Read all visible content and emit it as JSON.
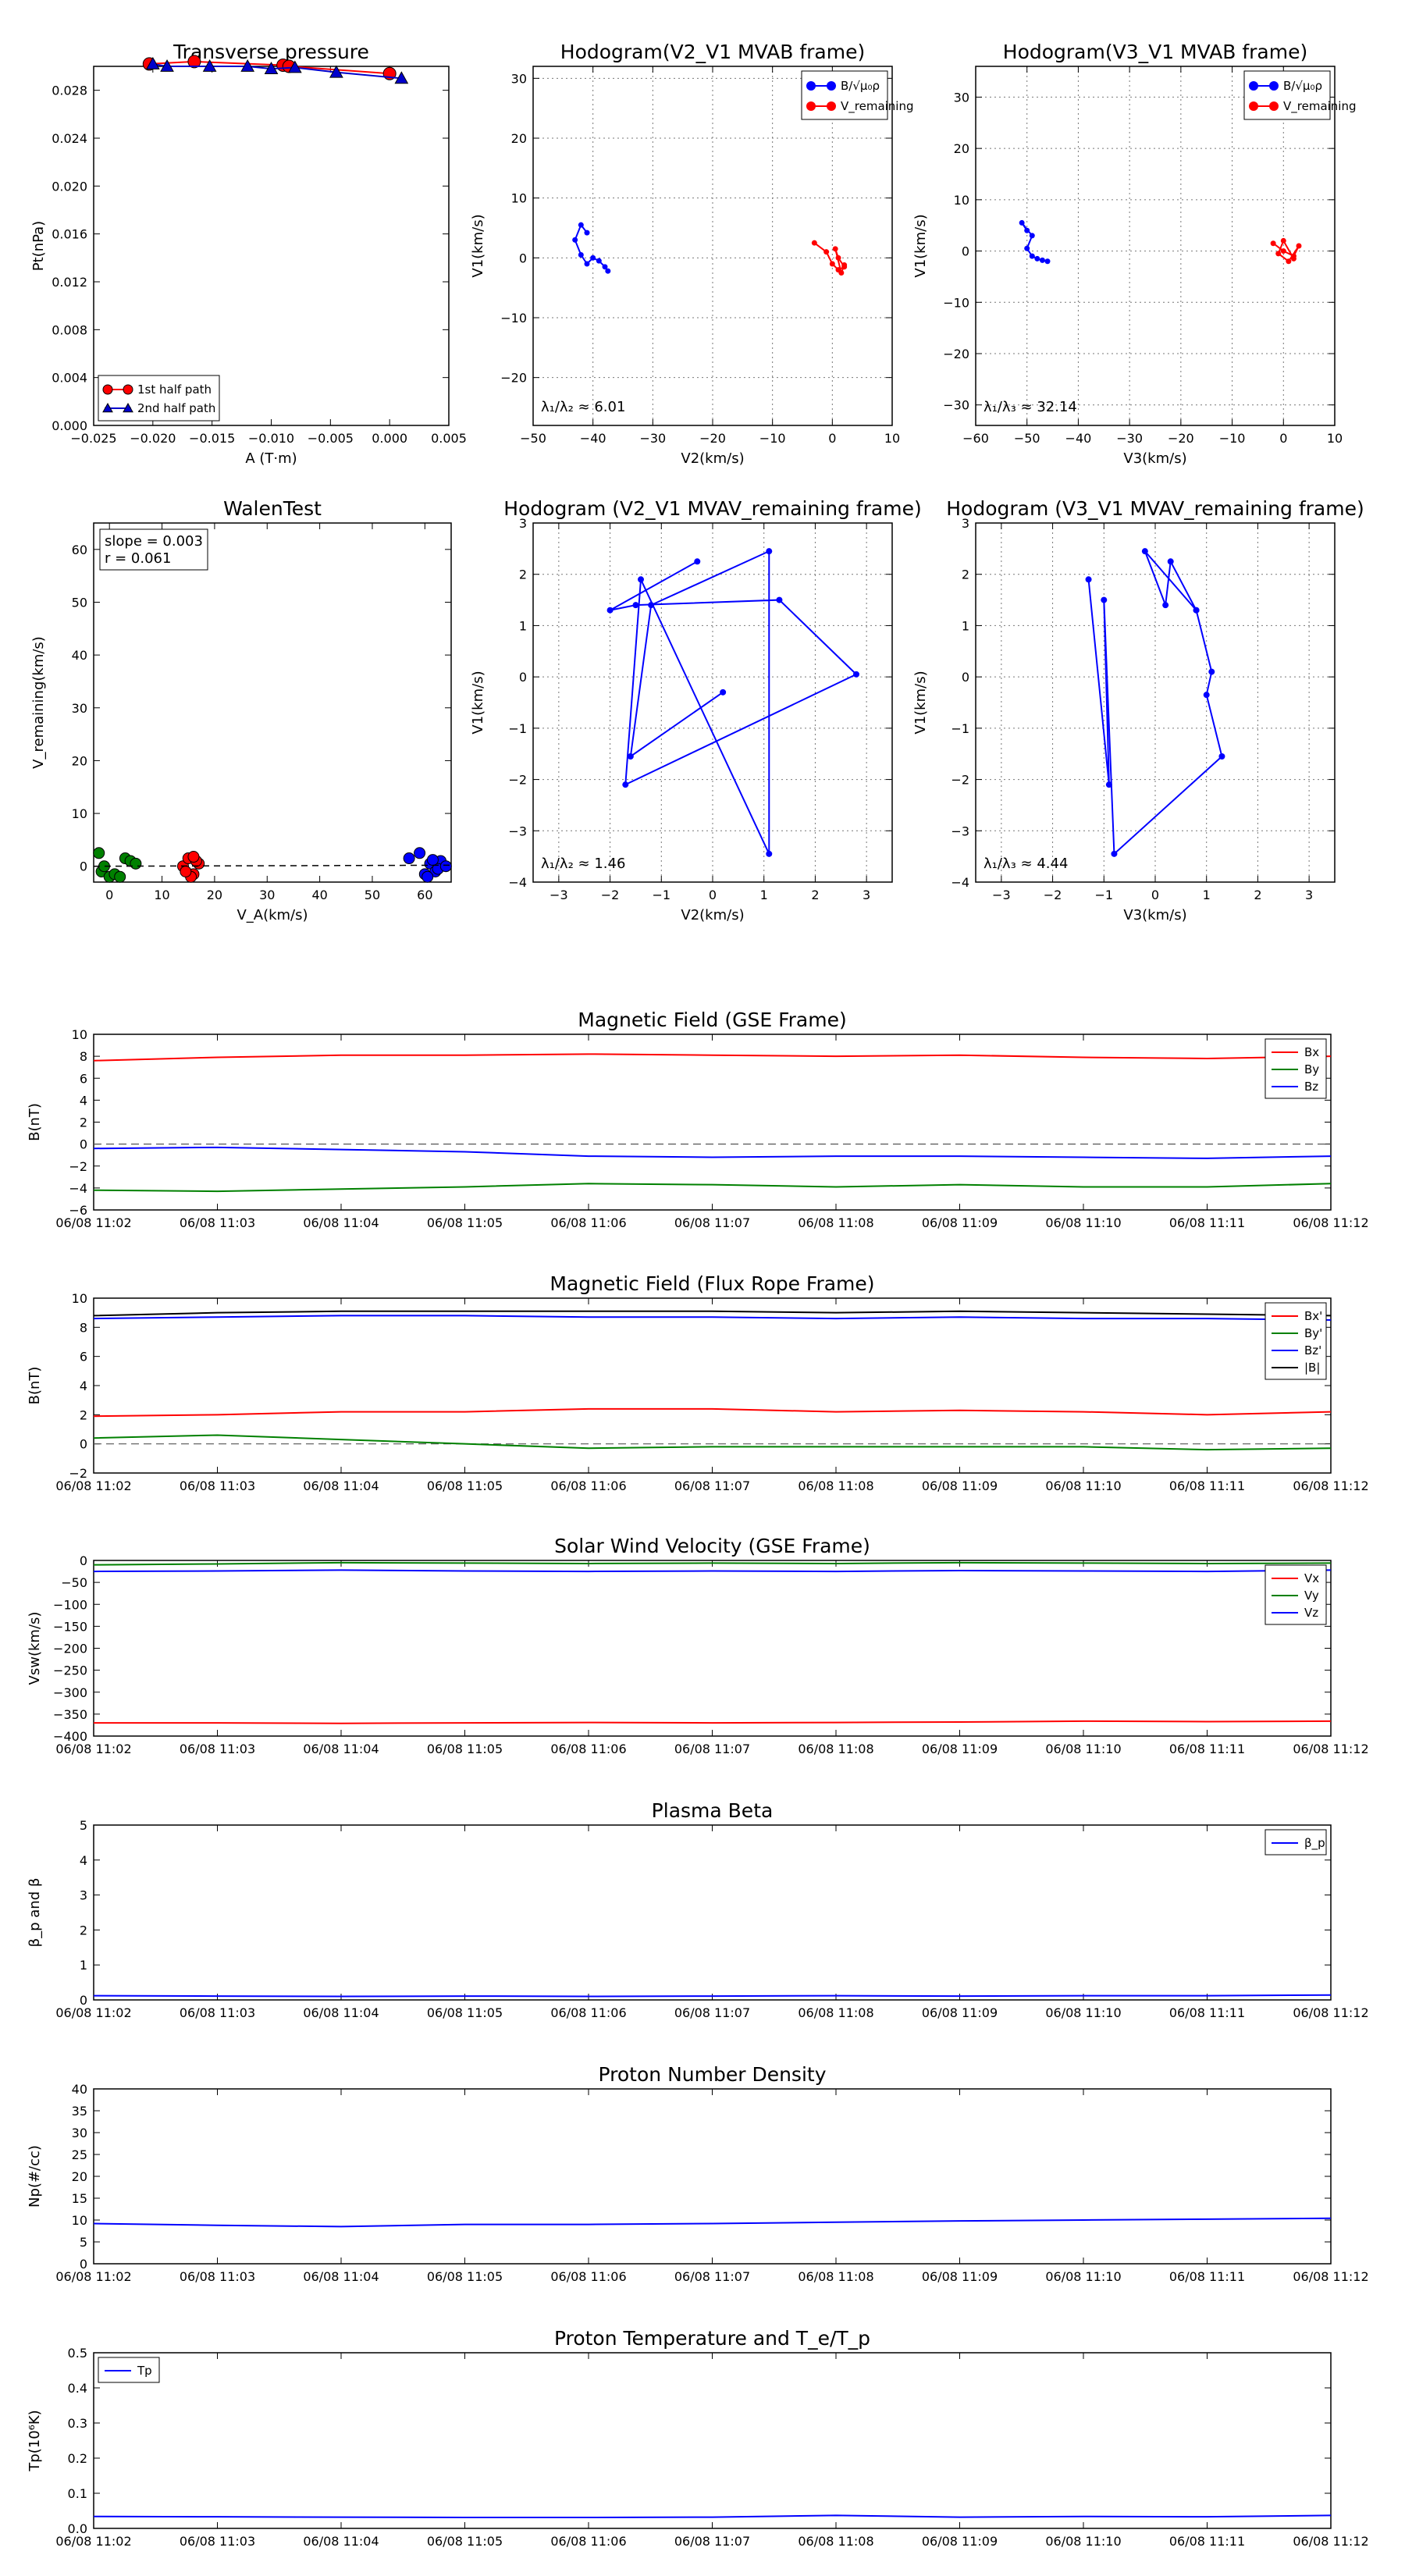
{
  "time_ticks": [
    "06/08 11:02",
    "06/08 11:03",
    "06/08 11:04",
    "06/08 11:05",
    "06/08 11:06",
    "06/08 11:07",
    "06/08 11:08",
    "06/08 11:09",
    "06/08 11:10",
    "06/08 11:11",
    "06/08 11:12"
  ],
  "chart_data": [
    {
      "id": "transverse",
      "type": "scatter",
      "title": "Transverse pressure",
      "xlabel": "A (T·m)",
      "ylabel": "Pt(nPa)",
      "xlim": [
        -0.025,
        0.005
      ],
      "ylim": [
        0,
        0.03
      ],
      "xticks": [
        -0.025,
        -0.02,
        -0.015,
        -0.01,
        -0.005,
        0.0,
        0.005
      ],
      "xtick_labels": [
        "−0.025",
        "−0.020",
        "−0.015",
        "−0.010",
        "−0.005",
        "0.000",
        "0.005"
      ],
      "yticks": [
        0,
        0.004,
        0.008,
        0.012,
        0.016,
        0.02,
        0.024,
        0.028
      ],
      "ytick_labels": [
        "0.000",
        "0.004",
        "0.008",
        "0.012",
        "0.016",
        "0.020",
        "0.024",
        "0.028"
      ],
      "grid": false,
      "legend": "bottom-left",
      "series": [
        {
          "name": "1st half path",
          "color": "#ff0000",
          "marker": "circle",
          "x": [
            -0.0203,
            -0.0165,
            -0.009,
            -0.0085,
            0.0
          ],
          "y": [
            0.0302,
            0.0304,
            0.0301,
            0.03,
            0.0294
          ]
        },
        {
          "name": "2nd half path",
          "color": "#0000cc",
          "marker": "triangle",
          "x": [
            -0.02,
            -0.0188,
            -0.0152,
            -0.012,
            -0.01,
            -0.008,
            -0.0045,
            0.001
          ],
          "y": [
            0.0302,
            0.03,
            0.03,
            0.03,
            0.0298,
            0.0299,
            0.0295,
            0.029
          ]
        }
      ]
    },
    {
      "id": "hodo1",
      "type": "scatter",
      "title": "Hodogram(V2_V1 MVAB frame)",
      "xlabel": "V2(km/s)",
      "ylabel": "V1(km/s)",
      "xlim": [
        -50,
        10
      ],
      "ylim": [
        -28,
        32
      ],
      "xticks": [
        -50,
        -40,
        -30,
        -20,
        -10,
        0,
        10
      ],
      "yticks": [
        -20,
        -10,
        0,
        10,
        20,
        30
      ],
      "grid": true,
      "legend": "top-right",
      "annotation": "λ₁/λ₂ ≈ 6.01",
      "series": [
        {
          "name": "B/√μ₀ρ",
          "color": "#0000ff",
          "x": [
            -41,
            -42,
            -43,
            -42,
            -41,
            -40,
            -39,
            -38,
            -37.5
          ],
          "y": [
            4.2,
            5.5,
            3.0,
            0.5,
            -1,
            0,
            -0.5,
            -1.5,
            -2.2
          ]
        },
        {
          "name": "V_remaining",
          "color": "#ff0000",
          "x": [
            -3,
            -1,
            0,
            1,
            2,
            1,
            0.5,
            1.5,
            2
          ],
          "y": [
            2.5,
            1,
            -1,
            -2,
            -1.5,
            0,
            1.5,
            -2.5,
            -1.2
          ]
        }
      ]
    },
    {
      "id": "hodo2",
      "type": "scatter",
      "title": "Hodogram(V3_V1 MVAB frame)",
      "xlabel": "V3(km/s)",
      "ylabel": "V1(km/s)",
      "xlim": [
        -60,
        10
      ],
      "ylim": [
        -34,
        36
      ],
      "xticks": [
        -60,
        -50,
        -40,
        -30,
        -20,
        -10,
        0,
        10
      ],
      "yticks": [
        -30,
        -20,
        -10,
        0,
        10,
        20,
        30
      ],
      "grid": true,
      "legend": "top-right",
      "annotation": "λ₁/λ₃ ≈ 32.14",
      "series": [
        {
          "name": "B/√μ₀ρ",
          "color": "#0000ff",
          "x": [
            -50,
            -51,
            -49,
            -50,
            -49,
            -48,
            -47,
            -46
          ],
          "y": [
            4,
            5.5,
            3,
            0.5,
            -1,
            -1.5,
            -1.8,
            -2
          ]
        },
        {
          "name": "V_remaining",
          "color": "#ff0000",
          "x": [
            -2,
            0,
            2,
            3,
            1,
            -1,
            0,
            2
          ],
          "y": [
            1.5,
            0,
            -1,
            1,
            -2,
            -0.5,
            2,
            -1.5
          ]
        }
      ]
    },
    {
      "id": "walen",
      "type": "scatter",
      "title": "WalenTest",
      "xlabel": "V_A(km/s)",
      "ylabel": "V_remaining(km/s)",
      "xlim": [
        -3,
        65
      ],
      "ylim": [
        -3,
        65
      ],
      "xticks": [
        0,
        10,
        20,
        30,
        40,
        50,
        60
      ],
      "yticks": [
        0,
        10,
        20,
        30,
        40,
        50,
        60
      ],
      "grid": false,
      "box_text": [
        "slope = 0.003",
        "r = 0.061"
      ],
      "fit": {
        "slope": 0.003,
        "intercept": 0
      },
      "series": [
        {
          "color": "#008000",
          "x": [
            -2,
            -1.5,
            0,
            -1,
            1,
            2,
            3,
            4,
            5
          ],
          "y": [
            2.5,
            -1,
            -2,
            0,
            -1.5,
            -2,
            1.5,
            1,
            0.5
          ]
        },
        {
          "color": "#ff0000",
          "x": [
            14,
            15,
            16,
            17,
            15.5,
            16.5,
            14.5,
            16
          ],
          "y": [
            0,
            1.5,
            -1.5,
            0.5,
            -2,
            1,
            -1,
            1.8
          ]
        },
        {
          "color": "#0000ff",
          "x": [
            57,
            59,
            60,
            61,
            62,
            63,
            60.5,
            62.5,
            64,
            61.5
          ],
          "y": [
            1.5,
            2.5,
            -1.5,
            0.5,
            -1,
            1,
            -2,
            -0.5,
            0,
            1.2
          ]
        }
      ]
    },
    {
      "id": "hodo3",
      "type": "line",
      "title": "Hodogram (V2_V1 MVAV_remaining frame)",
      "xlabel": "V2(km/s)",
      "ylabel": "V1(km/s)",
      "xlim": [
        -3.5,
        3.5
      ],
      "ylim": [
        -4,
        3
      ],
      "xticks": [
        -3,
        -2,
        -1,
        0,
        1,
        2,
        3
      ],
      "yticks": [
        -4,
        -3,
        -2,
        -1,
        0,
        1,
        2,
        3
      ],
      "grid": true,
      "annotation": "λ₁/λ₂ ≈ 1.46",
      "series": [
        {
          "color": "#0000ff",
          "x": [
            -0.3,
            -2.0,
            -1.5,
            1.3,
            2.8,
            -1.7,
            -1.4,
            1.1,
            1.1,
            -1.2,
            -1.6,
            0.2
          ],
          "y": [
            2.25,
            1.3,
            1.4,
            1.5,
            0.05,
            -2.1,
            1.9,
            -3.45,
            2.45,
            1.4,
            -1.55,
            -0.3
          ]
        }
      ]
    },
    {
      "id": "hodo4",
      "type": "line",
      "title": "Hodogram (V3_V1 MVAV_remaining frame)",
      "xlabel": "V3(km/s)",
      "ylabel": "V1(km/s)",
      "xlim": [
        -3.5,
        3.5
      ],
      "ylim": [
        -4,
        3
      ],
      "xticks": [
        -3,
        -2,
        -1,
        0,
        1,
        2,
        3
      ],
      "yticks": [
        -4,
        -3,
        -2,
        -1,
        0,
        1,
        2,
        3
      ],
      "grid": true,
      "annotation": "λ₁/λ₃ ≈ 4.44",
      "series": [
        {
          "color": "#0000ff",
          "x": [
            -1.3,
            -0.9,
            -1.0,
            -0.8,
            1.3,
            1.0,
            1.1,
            0.8,
            0.3,
            0.2,
            -0.2,
            0.8
          ],
          "y": [
            1.9,
            -2.1,
            1.5,
            -3.45,
            -1.55,
            -0.35,
            0.1,
            1.3,
            2.25,
            1.4,
            2.45,
            1.3
          ]
        }
      ]
    },
    {
      "id": "mag_gse",
      "type": "line",
      "title": "Magnetic Field (GSE Frame)",
      "ylabel": "B(nT)",
      "ylim": [
        -6,
        10
      ],
      "yticks": [
        -6,
        -4,
        -2,
        0,
        2,
        4,
        6,
        8,
        10
      ],
      "hline": 0,
      "legend": "top-right",
      "series": [
        {
          "name": "Bx",
          "color": "#ff0000",
          "values": [
            7.6,
            7.9,
            8.1,
            8.1,
            8.2,
            8.1,
            8.0,
            8.1,
            7.9,
            7.8,
            8.0
          ]
        },
        {
          "name": "By",
          "color": "#008000",
          "values": [
            -4.2,
            -4.3,
            -4.1,
            -3.9,
            -3.6,
            -3.7,
            -3.9,
            -3.7,
            -3.9,
            -3.9,
            -3.6
          ]
        },
        {
          "name": "Bz",
          "color": "#0000ff",
          "values": [
            -0.4,
            -0.3,
            -0.5,
            -0.7,
            -1.1,
            -1.2,
            -1.1,
            -1.1,
            -1.2,
            -1.3,
            -1.1
          ]
        }
      ]
    },
    {
      "id": "mag_fr",
      "type": "line",
      "title": "Magnetic Field (Flux Rope Frame)",
      "ylabel": "B(nT)",
      "ylim": [
        -2,
        10
      ],
      "yticks": [
        -2,
        0,
        2,
        4,
        6,
        8,
        10
      ],
      "hline": 0,
      "legend": "top-right",
      "series": [
        {
          "name": "Bx'",
          "color": "#ff0000",
          "values": [
            1.9,
            2.0,
            2.2,
            2.2,
            2.4,
            2.4,
            2.2,
            2.3,
            2.2,
            2.0,
            2.2
          ]
        },
        {
          "name": "By'",
          "color": "#008000",
          "values": [
            0.4,
            0.6,
            0.3,
            0.0,
            -0.3,
            -0.2,
            -0.2,
            -0.2,
            -0.2,
            -0.4,
            -0.3
          ]
        },
        {
          "name": "Bz'",
          "color": "#0000ff",
          "values": [
            8.6,
            8.7,
            8.8,
            8.8,
            8.7,
            8.7,
            8.6,
            8.7,
            8.6,
            8.6,
            8.5
          ]
        },
        {
          "name": "|B|",
          "color": "#000000",
          "values": [
            8.8,
            9.0,
            9.1,
            9.1,
            9.1,
            9.1,
            9.0,
            9.1,
            9.0,
            8.9,
            8.8
          ]
        }
      ]
    },
    {
      "id": "vsw",
      "type": "line",
      "title": "Solar Wind Velocity (GSE Frame)",
      "ylabel": "Vsw(km/s)",
      "ylim": [
        -400,
        0
      ],
      "yticks": [
        -400,
        -350,
        -300,
        -250,
        -200,
        -150,
        -100,
        -50,
        0
      ],
      "legend": "top-right",
      "series": [
        {
          "name": "Vx",
          "color": "#ff0000",
          "values": [
            -370,
            -370,
            -371,
            -370,
            -369,
            -370,
            -369,
            -368,
            -366,
            -367,
            -366
          ]
        },
        {
          "name": "Vy",
          "color": "#008000",
          "values": [
            -10,
            -8,
            -5,
            -6,
            -7,
            -6,
            -7,
            -5,
            -6,
            -7,
            -6
          ]
        },
        {
          "name": "Vz",
          "color": "#0000ff",
          "values": [
            -25,
            -24,
            -22,
            -24,
            -25,
            -24,
            -25,
            -23,
            -24,
            -25,
            -22
          ]
        }
      ]
    },
    {
      "id": "beta",
      "type": "line",
      "title": "Plasma Beta",
      "ylabel": "β_p and β",
      "ylim": [
        0,
        5
      ],
      "yticks": [
        0,
        1,
        2,
        3,
        4,
        5
      ],
      "legend": "top-right",
      "series": [
        {
          "name": "β_p",
          "color": "#0000ff",
          "values": [
            0.12,
            0.11,
            0.1,
            0.11,
            0.1,
            0.11,
            0.12,
            0.11,
            0.12,
            0.12,
            0.14
          ]
        }
      ]
    },
    {
      "id": "np",
      "type": "line",
      "title": "Proton Number Density",
      "ylabel": "Np(#/cc)",
      "ylim": [
        0,
        40
      ],
      "yticks": [
        0,
        5,
        10,
        15,
        20,
        25,
        30,
        35,
        40
      ],
      "series": [
        {
          "color": "#0000ff",
          "values": [
            9.2,
            8.8,
            8.5,
            9.0,
            9.0,
            9.2,
            9.5,
            9.8,
            10.0,
            10.2,
            10.4
          ]
        }
      ]
    },
    {
      "id": "tp",
      "type": "line",
      "title": "Proton Temperature and T_e/T_p",
      "ylabel": "Tp(10⁶K)",
      "ylim": [
        0,
        0.5
      ],
      "yticks": [
        0,
        0.1,
        0.2,
        0.3,
        0.4,
        0.5
      ],
      "ytick_labels": [
        "0.0",
        "0.1",
        "0.2",
        "0.3",
        "0.4",
        "0.5"
      ],
      "legend": "top-left",
      "series": [
        {
          "name": "Tp",
          "color": "#0000ff",
          "values": [
            0.034,
            0.033,
            0.032,
            0.031,
            0.031,
            0.032,
            0.037,
            0.032,
            0.034,
            0.033,
            0.037
          ]
        }
      ]
    }
  ]
}
